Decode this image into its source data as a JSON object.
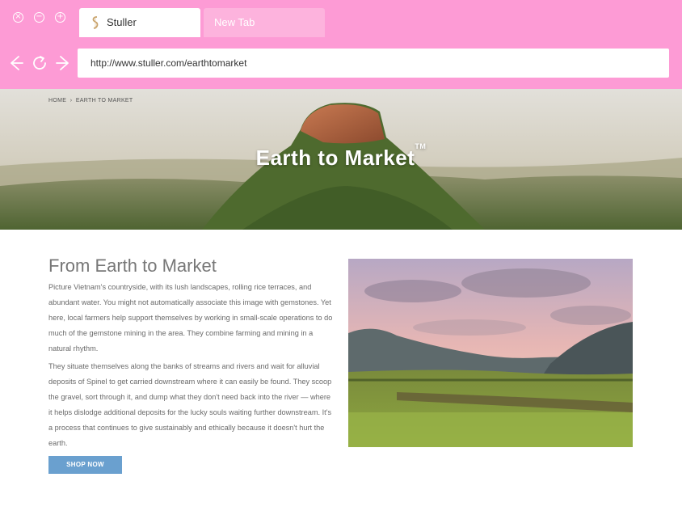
{
  "browser": {
    "tabs": [
      {
        "label": "Stuller",
        "active": true
      },
      {
        "label": "New Tab",
        "active": false
      }
    ],
    "url": "http://www.stuller.com/earthtomarket",
    "chrome_color": "#fd9bd5"
  },
  "hero": {
    "breadcrumb": [
      "HOME",
      "EARTH TO MARKET"
    ],
    "title": "Earth to Market",
    "trademark": "TM"
  },
  "content": {
    "heading": "From Earth to Market",
    "paragraphs": [
      "Picture Vietnam's countryside, with its lush landscapes, rolling rice terraces, and abundant water. You might not automatically associate this image with gemstones. Yet here, local farmers help support themselves by working in small-scale operations to do much of the gemstone mining in the area. They combine farming and mining in a natural rhythm.",
      "They situate themselves along the banks of streams and rivers and wait for alluvial deposits of Spinel to get carried downstream where it can easily be found. They scoop the gravel, sort through it, and dump what they don't need back into the river — where it helps dislodge additional deposits for the lucky souls waiting further downstream. It's a process that continues to give sustainably and ethically because it doesn't hurt the earth."
    ],
    "shop_button": "SHOP NOW",
    "button_color": "#6aa0cf"
  }
}
